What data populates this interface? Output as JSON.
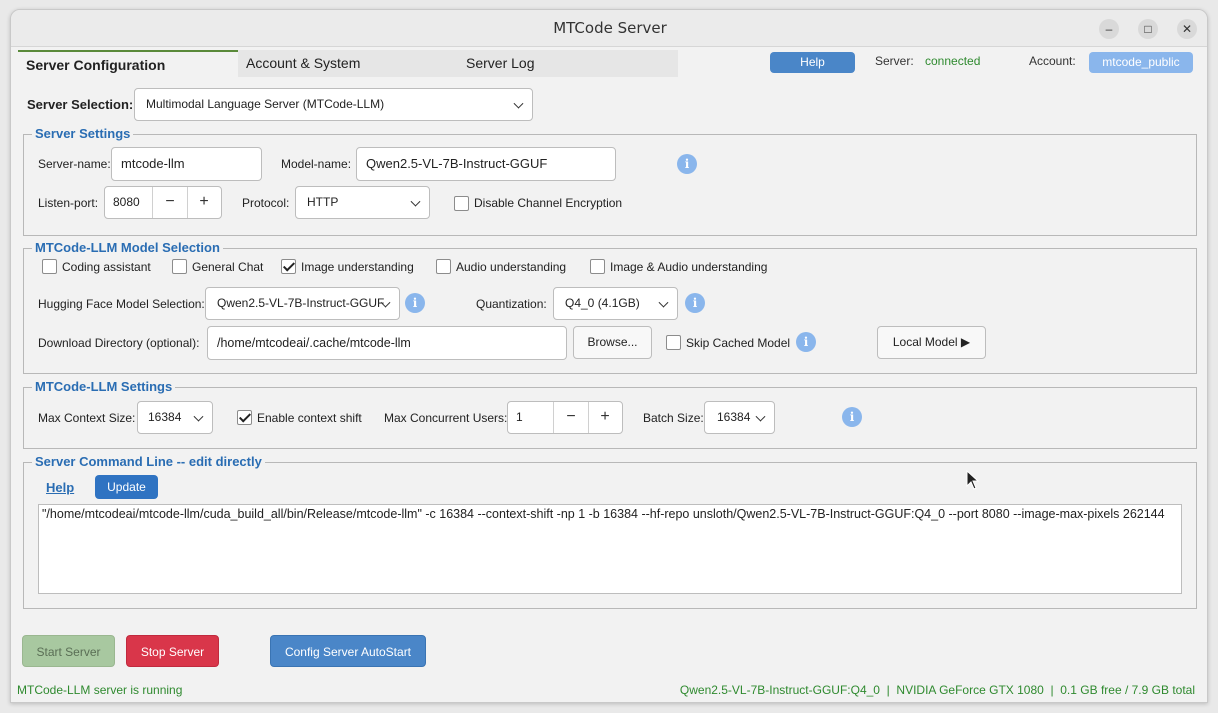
{
  "window": {
    "title": "MTCode Server"
  },
  "tabs": [
    "Server Configuration",
    "Account & System",
    "Server Log"
  ],
  "header": {
    "help_label": "Help",
    "server_label": "Server:",
    "server_status": "connected",
    "account_label": "Account:",
    "account_value": "mtcode_public"
  },
  "server_selection": {
    "label": "Server Selection:",
    "value": "Multimodal Language Server (MTCode-LLM)"
  },
  "server_settings": {
    "title": "Server Settings",
    "server_name_label": "Server-name:",
    "server_name": "mtcode-llm",
    "model_name_label": "Model-name:",
    "model_name": "Qwen2.5-VL-7B-Instruct-GGUF",
    "listen_port_label": "Listen-port:",
    "listen_port": "8080",
    "protocol_label": "Protocol:",
    "protocol": "HTTP",
    "disable_encryption_label": "Disable Channel Encryption",
    "disable_encryption_checked": false
  },
  "model_selection": {
    "title": "MTCode-LLM Model Selection",
    "options": [
      {
        "label": "Coding assistant",
        "checked": false
      },
      {
        "label": "General Chat",
        "checked": false
      },
      {
        "label": "Image understanding",
        "checked": true
      },
      {
        "label": "Audio understanding",
        "checked": false
      },
      {
        "label": "Image & Audio understanding",
        "checked": false
      }
    ],
    "hf_label": "Hugging Face Model Selection:",
    "hf_model": "Qwen2.5-VL-7B-Instruct-GGUF",
    "quant_label": "Quantization:",
    "quant": "Q4_0 (4.1GB)",
    "download_label": "Download Directory (optional):",
    "download_dir": "/home/mtcodeai/.cache/mtcode-llm",
    "browse_label": "Browse...",
    "skip_cached_label": "Skip Cached Model",
    "skip_cached_checked": false,
    "local_model_label": "Local Model ▶"
  },
  "llm_settings": {
    "title": "MTCode-LLM Settings",
    "max_context_label": "Max Context Size:",
    "max_context": "16384",
    "context_shift_label": "Enable context shift",
    "context_shift_checked": true,
    "max_users_label": "Max Concurrent Users:",
    "max_users": "1",
    "batch_label": "Batch Size:",
    "batch": "16384"
  },
  "command_line": {
    "title": "Server Command Line  --  edit directly",
    "help_link": "Help",
    "update_label": "Update",
    "text": "\"/home/mtcodeai/mtcode-llm/cuda_build_all/bin/Release/mtcode-llm\" -c 16384 --context-shift -np 1 -b 16384 --hf-repo unsloth/Qwen2.5-VL-7B-Instruct-GGUF:Q4_0 --port 8080 --image-max-pixels 262144"
  },
  "actions": {
    "start": "Start Server",
    "stop": "Stop Server",
    "autostart": "Config Server AutoStart"
  },
  "statusbar": {
    "left": "MTCode-LLM server is running",
    "right": "Qwen2.5-VL-7B-Instruct-GGUF:Q4_0  |  NVIDIA GeForce GTX 1080  |  0.1 GB free / 7.9 GB total"
  },
  "icons": {
    "minimize": "minimize-icon",
    "maximize": "maximize-icon",
    "close": "close-icon",
    "info": "info-icon",
    "dropdown": "chevron-down-icon"
  },
  "colors": {
    "accent": "#4a86c8",
    "group_title": "#2a6db3",
    "status_green": "#2f8a2f",
    "stop_red": "#d9364a",
    "start_green": "#a8c8a0"
  }
}
